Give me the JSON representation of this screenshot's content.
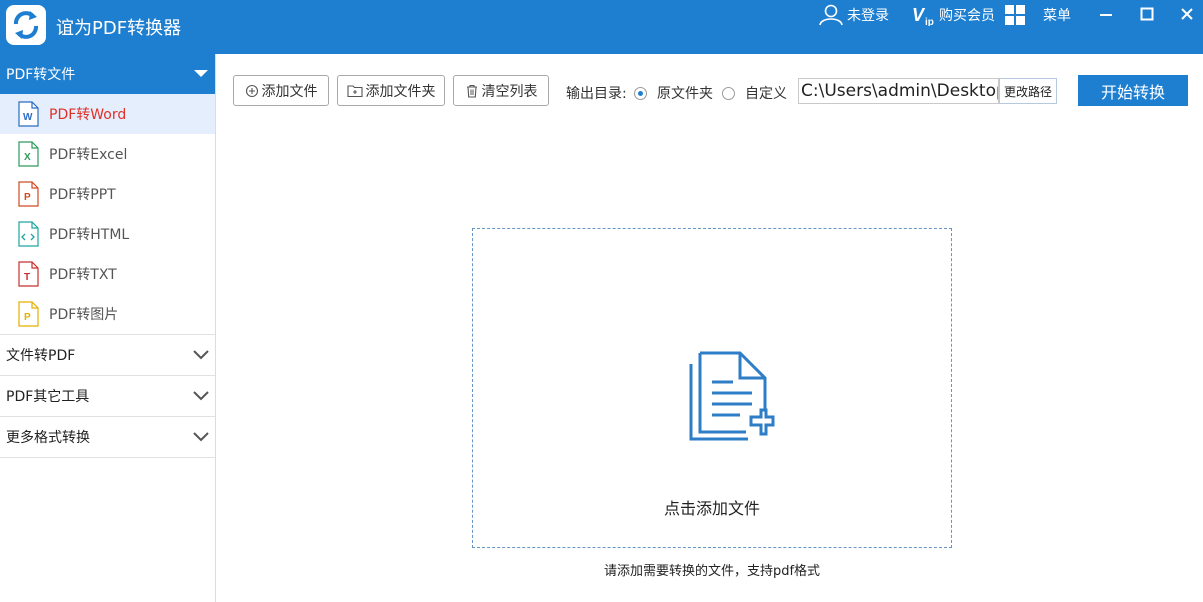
{
  "app": {
    "title": "谊为PDF转换器"
  },
  "titlebar": {
    "login": "未登录",
    "vip": "购买会员",
    "menu": "菜单"
  },
  "sidebar": {
    "groups": [
      {
        "label": "PDF转文件",
        "expanded": true
      },
      {
        "label": "文件转PDF",
        "expanded": false
      },
      {
        "label": "PDF其它工具",
        "expanded": false
      },
      {
        "label": "更多格式转换",
        "expanded": false
      }
    ],
    "items": [
      {
        "label": "PDF转Word",
        "icon": "word-file-icon",
        "color": "#2b6cc4"
      },
      {
        "label": "PDF转Excel",
        "icon": "excel-file-icon",
        "color": "#2e9b5e"
      },
      {
        "label": "PDF转PPT",
        "icon": "ppt-file-icon",
        "color": "#d04a23"
      },
      {
        "label": "PDF转HTML",
        "icon": "html-file-icon",
        "color": "#1fa4a0"
      },
      {
        "label": "PDF转TXT",
        "icon": "txt-file-icon",
        "color": "#c8312c"
      },
      {
        "label": "PDF转图片",
        "icon": "image-file-icon",
        "color": "#e3b000"
      }
    ]
  },
  "toolbar": {
    "add_file": "添加文件",
    "add_folder": "添加文件夹",
    "clear_list": "清空列表",
    "output_label": "输出目录:",
    "radio_original": "原文件夹",
    "radio_custom": "自定义",
    "path_value": "C:\\Users\\admin\\Desktop",
    "change_path": "更改路径",
    "start": "开始转换"
  },
  "dropzone": {
    "label": "点击添加文件",
    "hint": "请添加需要转换的文件，支持pdf格式"
  },
  "colors": {
    "accent": "#1e7fd1",
    "selected_text": "#e0302a",
    "selected_bg": "#e5eefc"
  }
}
